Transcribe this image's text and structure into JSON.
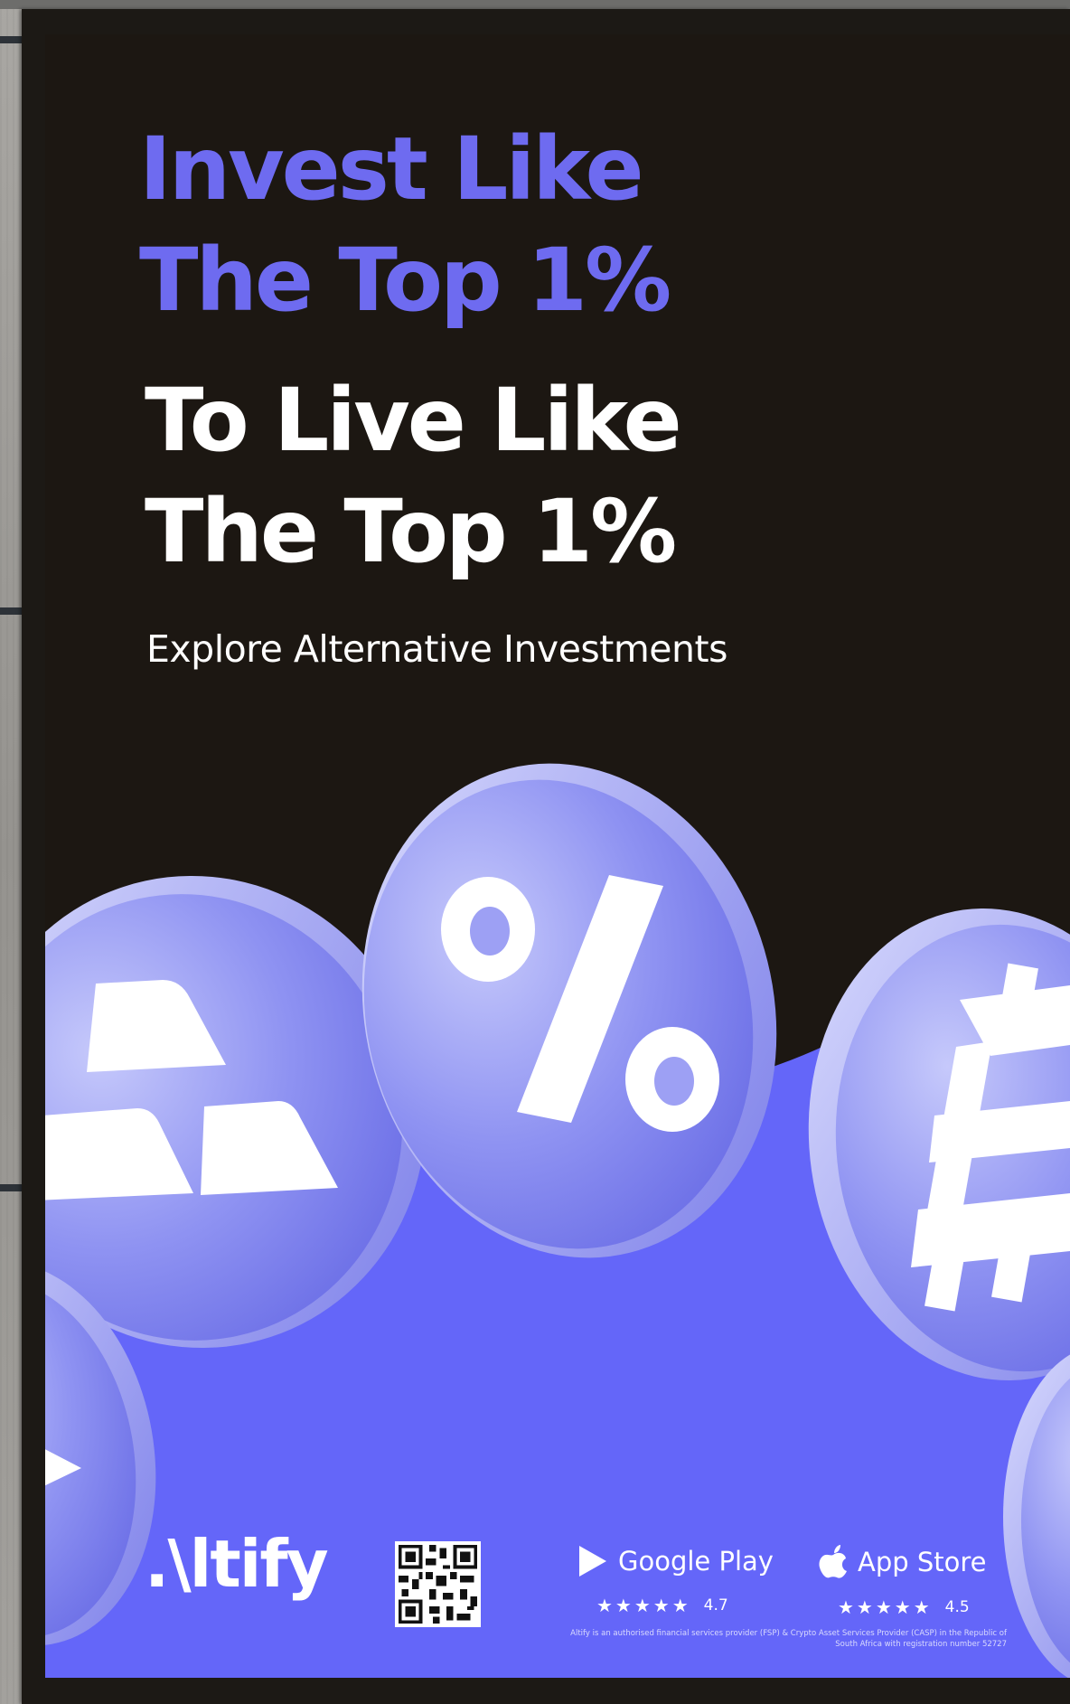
{
  "headline": {
    "blue_line1": "Invest Like",
    "blue_line2": "The Top 1%",
    "white_line1": "To Live Like",
    "white_line2": "The Top 1%"
  },
  "subheadline": "Explore Alternative Investments",
  "coins": [
    {
      "symbol": "gold-bars-icon"
    },
    {
      "symbol": "%"
    },
    {
      "symbol": "bitcoin-icon"
    }
  ],
  "brand": {
    "logo_text": ".\\ltify"
  },
  "stores": [
    {
      "name": "Google Play",
      "icon": "google-play-icon",
      "stars": "★★★★★",
      "rating": "4.7"
    },
    {
      "name": "App Store",
      "icon": "apple-icon",
      "stars": "★★★★★",
      "rating": "4.5"
    }
  ],
  "disclaimer": "Altify is an authorised financial services provider (FSP) & Crypto Asset Services Provider (CASP) in the Republic of South Africa with registration number 52727",
  "colors": {
    "accent_blue": "#6e6bf0",
    "background": "#1c1712",
    "coin": "#8a8cf2",
    "white": "#ffffff"
  }
}
